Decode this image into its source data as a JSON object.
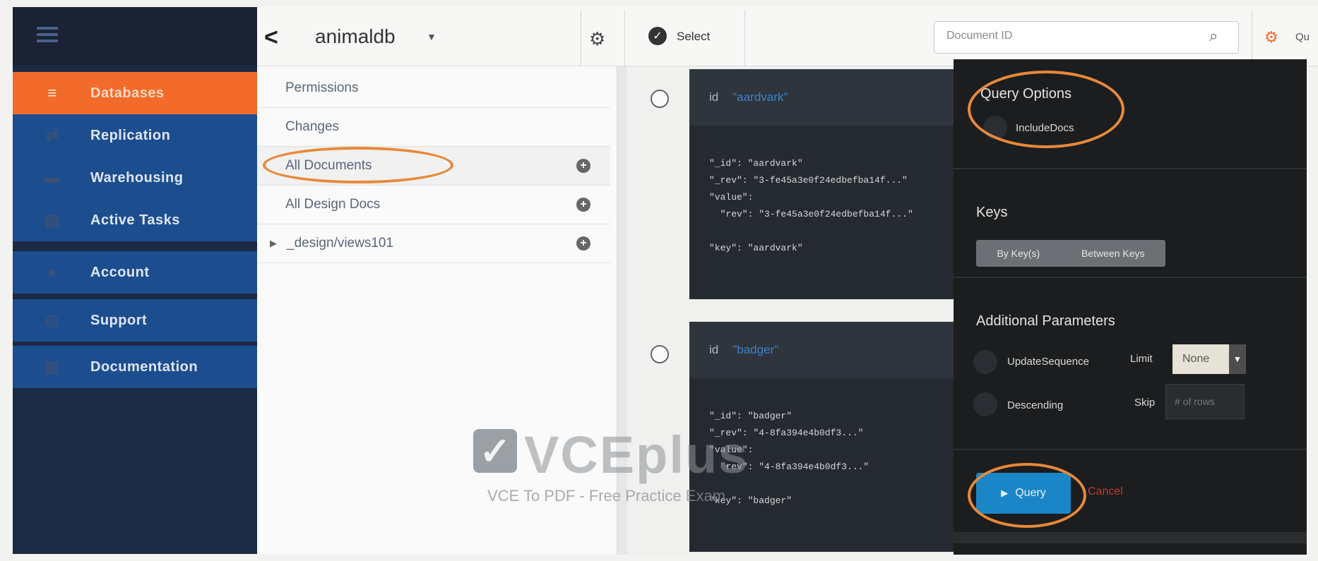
{
  "nav": {
    "items": [
      {
        "label": "Databases",
        "icon": "database-icon"
      },
      {
        "label": "Replication",
        "icon": "replication-icon"
      },
      {
        "label": "Warehousing",
        "icon": "warehouse-icon"
      },
      {
        "label": "Active Tasks",
        "icon": "tasks-icon"
      },
      {
        "label": "Account",
        "icon": "account-icon"
      },
      {
        "label": "Support",
        "icon": "support-icon"
      },
      {
        "label": "Documentation",
        "icon": "documentation-icon"
      }
    ]
  },
  "header": {
    "db_name": "animaldb",
    "select_label": "Select",
    "search_placeholder": "Document ID",
    "query_options_label": "Qu"
  },
  "sidebar": {
    "items": [
      {
        "label": "Permissions"
      },
      {
        "label": "Changes"
      },
      {
        "label": "All Documents"
      },
      {
        "label": "All Design Docs"
      },
      {
        "label": "_design/views101"
      }
    ]
  },
  "documents": [
    {
      "id_label": "id",
      "id_value": "\"aardvark\"",
      "json": "\"_id\": \"aardvark\"\n\"_rev\": \"3-fe45a3e0f24edbefba14f...\"\n\"value\":\n  \"rev\": \"3-fe45a3e0f24edbefba14f...\"\n\n\"key\": \"aardvark\""
    },
    {
      "id_label": "id",
      "id_value": "\"badger\"",
      "json": "\"_id\": \"badger\"\n\"_rev\": \"4-8fa394e4b0df3...\"\n\"value\":\n  \"rev\": \"4-8fa394e4b0df3...\"\n\n\"key\": \"badger\""
    }
  ],
  "query_panel": {
    "title": "Query Options",
    "include_docs": "IncludeDocs",
    "keys_title": "Keys",
    "keys_btn_a": "By Key(s)",
    "keys_btn_b": "Between Keys",
    "additional_title": "Additional Parameters",
    "update_seq": "UpdateSequence",
    "limit_label": "Limit",
    "limit_value": "None",
    "descending": "Descending",
    "skip_label": "Skip",
    "skip_placeholder": "# of rows",
    "query_btn": "Query",
    "cancel": "Cancel"
  },
  "watermark": {
    "check": "✓",
    "brand": "VCEplus",
    "tagline": "VCE To PDF - Free Practice Exam"
  },
  "colors": {
    "accent_orange": "#f26b2a",
    "nav_blue": "#1c4e8f",
    "query_blue": "#1a86c8",
    "highlight_ring": "#e8893a"
  }
}
